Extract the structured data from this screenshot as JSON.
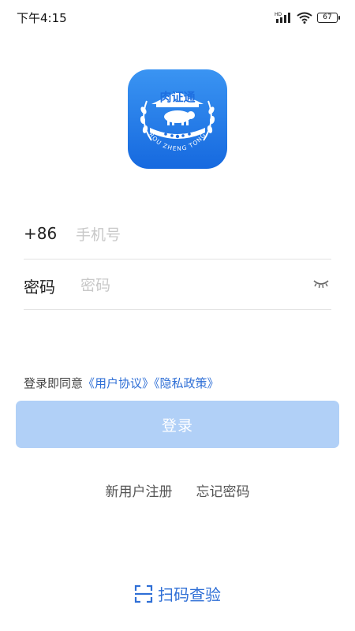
{
  "status_bar": {
    "time": "下午4:15",
    "network_label": "HD",
    "battery_level": "67"
  },
  "logo": {
    "name": "肉证通",
    "arc_text": "ROU ZHENG TONG",
    "colors": {
      "background": "#1f7de8",
      "emblem": "#ffffff"
    }
  },
  "phone_field": {
    "prefix": "+86",
    "placeholder": "手机号",
    "value": ""
  },
  "password_field": {
    "label": "密码",
    "placeholder": "密码",
    "value": ""
  },
  "agreement": {
    "prefix": "登录即同意",
    "user_agreement": "《用户协议》",
    "privacy_policy": "《隐私政策》"
  },
  "login_button": {
    "label": "登录",
    "color": "#b1d0f7"
  },
  "links": {
    "register": "新用户注册",
    "forgot_password": "忘记密码"
  },
  "scan": {
    "label": "扫码查验",
    "color": "#2f6fd6"
  }
}
